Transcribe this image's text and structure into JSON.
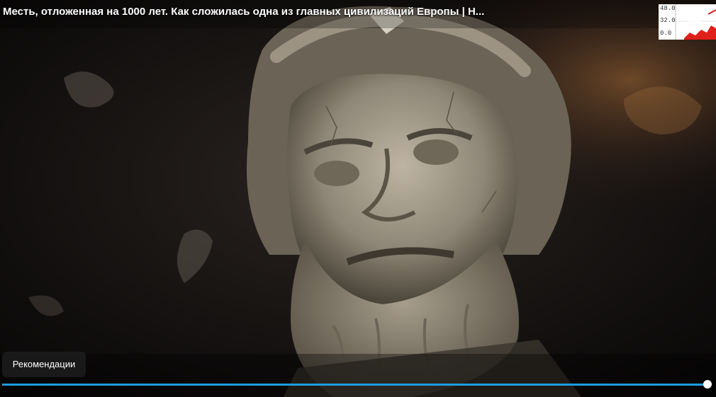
{
  "video": {
    "title": "Месть, отложенная на 1000 лет. Как сложилась одна из главных цивилизаций Европы | Н...",
    "recommendations_label": "Рекомендации",
    "progress": 1.0,
    "accent_color": "#1e9be0"
  },
  "overlay_chart": {
    "tick_top": "48.0",
    "tick_mid": "32.0",
    "tick_bottom": "0.0"
  },
  "icons": {
    "share": "share-arrow-icon"
  }
}
